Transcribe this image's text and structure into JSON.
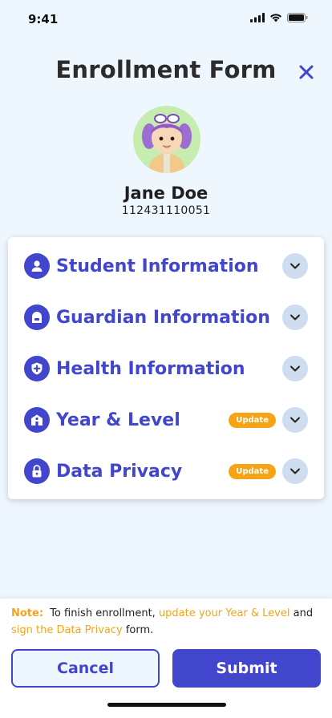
{
  "status_bar": {
    "time": "9:41",
    "icons": [
      "signal-icon",
      "wifi-icon",
      "battery-icon"
    ]
  },
  "header": {
    "title": "Enrollment Form",
    "close_icon": "close-icon"
  },
  "profile": {
    "name": "Jane Doe",
    "id": "112431110051",
    "avatar": "avatar"
  },
  "sections": [
    {
      "label": "Student Information",
      "icon": "person-icon",
      "badge": ""
    },
    {
      "label": "Guardian Information",
      "icon": "guardian-icon",
      "badge": ""
    },
    {
      "label": "Health Information",
      "icon": "health-shield-icon",
      "badge": ""
    },
    {
      "label": "Year & Level",
      "icon": "school-icon",
      "badge": "Update"
    },
    {
      "label": "Data Privacy",
      "icon": "lock-icon",
      "badge": "Update"
    }
  ],
  "note": {
    "label": "Note:",
    "text_1": "To finish enrollment,",
    "link_1": "update your Year & Level",
    "text_2": "and",
    "link_2": "sign the Data Privacy",
    "text_3": "form."
  },
  "buttons": {
    "cancel": "Cancel",
    "submit": "Submit"
  },
  "colors": {
    "primary": "#4146cc",
    "accent": "#f5a416",
    "background": "#eef6fe",
    "chevron_bg": "#cdddee"
  }
}
